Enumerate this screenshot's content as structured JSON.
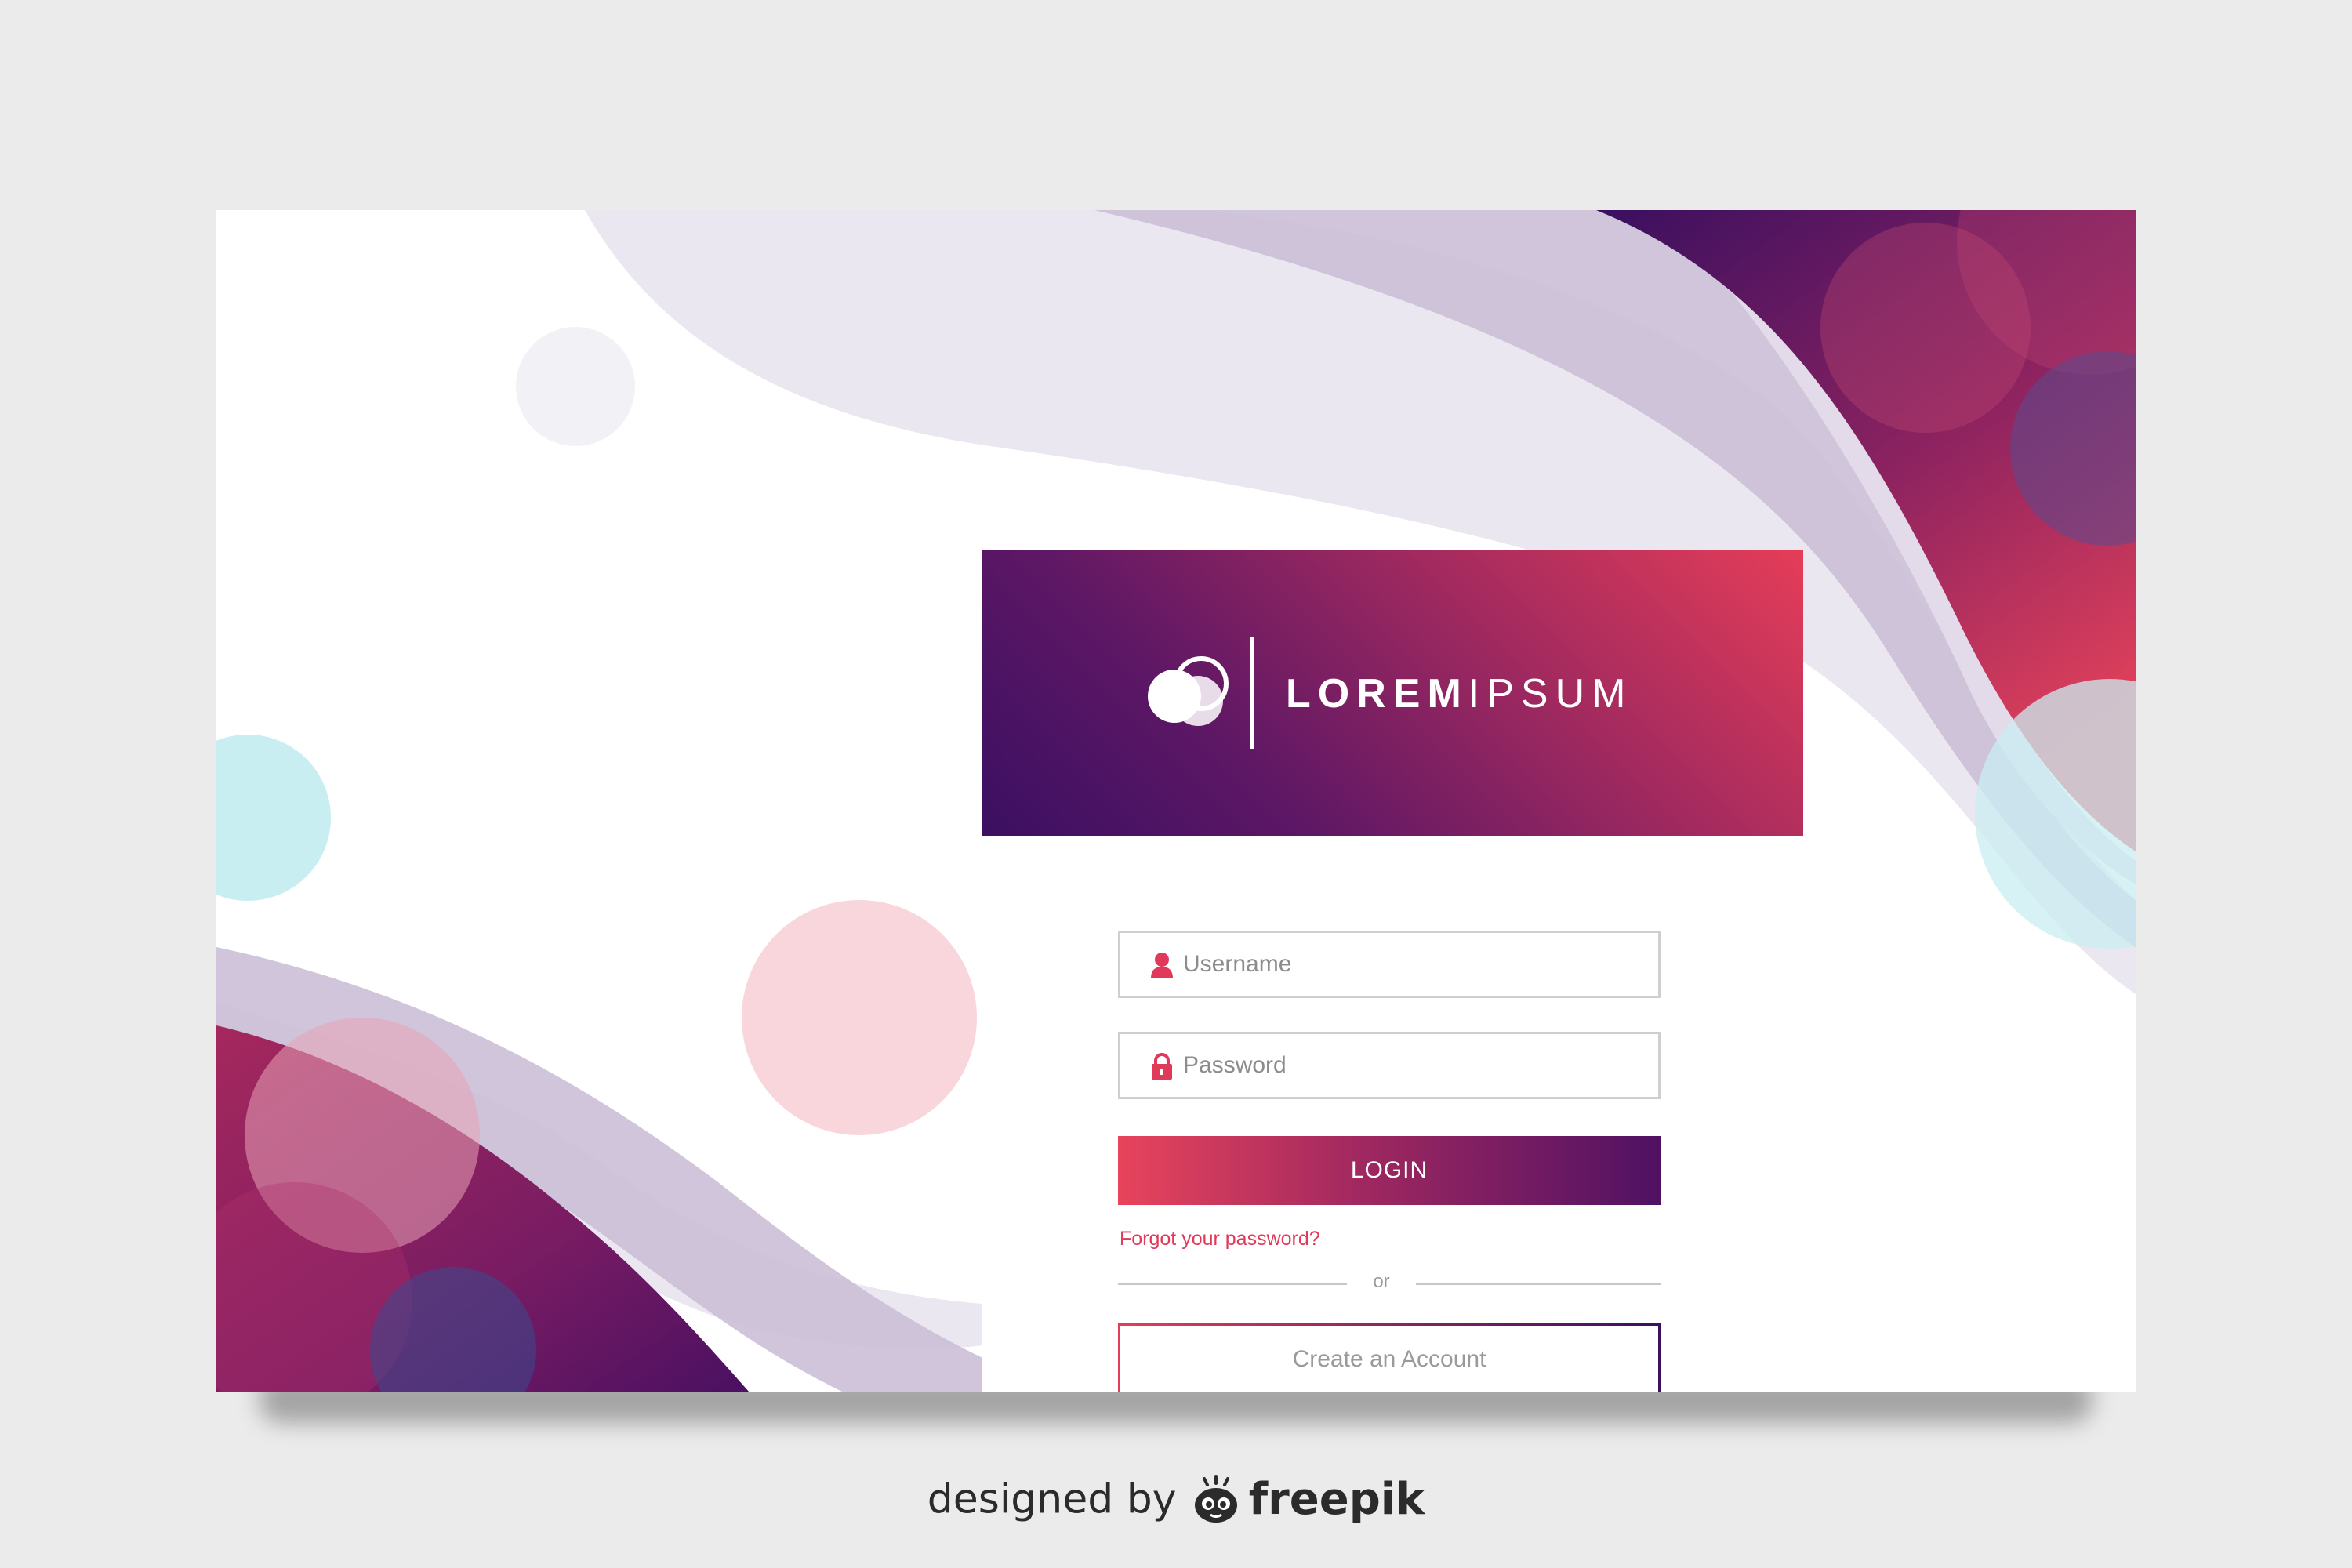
{
  "brand": {
    "name_bold": "LOREM",
    "name_light": "IPSUM",
    "logo_icon": "overlapping-circles-logo"
  },
  "form": {
    "username": {
      "placeholder": "Username",
      "value": "",
      "icon": "user-icon"
    },
    "password": {
      "placeholder": "Password",
      "value": "",
      "icon": "lock-icon"
    },
    "login_label": "LOGIN",
    "forgot_label": "Forgot your password?",
    "separator_label": "or",
    "create_account_label": "Create an Account"
  },
  "credit": {
    "prefix": "designed by",
    "brand": "freepik",
    "icon": "freepik-logo-icon"
  },
  "colors": {
    "accent_pink": "#e53d58",
    "accent_purple": "#3b0f62",
    "bubble_cyan": "#c9eef2",
    "bubble_pink": "#f9d6dc",
    "wave_lilac": "#cbbfd6",
    "page_background": "#ebebeb"
  }
}
